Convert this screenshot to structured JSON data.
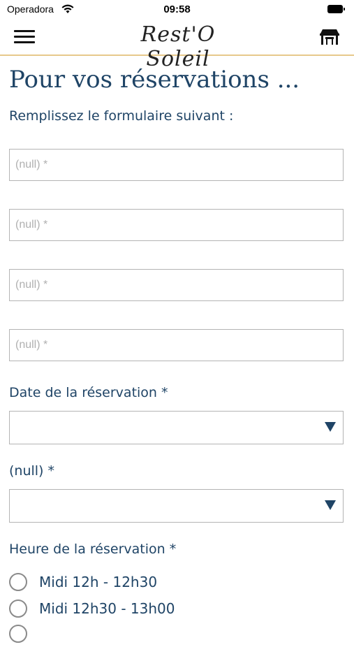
{
  "status_bar": {
    "carrier": "Operadora",
    "time": "09:58"
  },
  "nav": {
    "logo_text": "Rest'O Soleil",
    "menu_icon": "hamburger-icon",
    "right_icon": "restaurant-icon"
  },
  "page": {
    "title": "Pour vos réservations ...",
    "subtitle": "Remplissez le formulaire suivant :"
  },
  "form": {
    "fields": [
      {
        "placeholder": "(null) *"
      },
      {
        "placeholder": "(null) *"
      },
      {
        "placeholder": "(null) *"
      },
      {
        "placeholder": "(null) *"
      }
    ],
    "date_label": "Date de la réservation *",
    "date_value": "",
    "second_select_label": "(null) *",
    "second_select_value": "",
    "time_label": "Heure de la réservation *",
    "time_options": [
      {
        "label": "Midi 12h - 12h30",
        "selected": false
      },
      {
        "label": "Midi 12h30 - 13h00",
        "selected": false
      }
    ]
  },
  "colors": {
    "accent": "#1f4466",
    "divider": "#e7c98b",
    "border": "#b4b4b4"
  }
}
